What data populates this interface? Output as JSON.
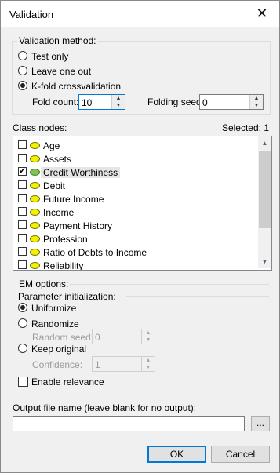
{
  "window": {
    "title": "Validation"
  },
  "validation": {
    "legend": "Validation method:",
    "options": [
      "Test only",
      "Leave one out",
      "K-fold crossvalidation"
    ],
    "selected": "K-fold crossvalidation",
    "fold_count_label": "Fold count:",
    "fold_count": "10",
    "folding_seed_label": "Folding seed:",
    "folding_seed": "0"
  },
  "class_nodes": {
    "label": "Class nodes:",
    "selected_text": "Selected: 1",
    "items": [
      {
        "label": "Age",
        "checked": false,
        "color": "yellow"
      },
      {
        "label": "Assets",
        "checked": false,
        "color": "yellow"
      },
      {
        "label": "Credit Worthiness",
        "checked": true,
        "color": "green"
      },
      {
        "label": "Debit",
        "checked": false,
        "color": "yellow"
      },
      {
        "label": "Future Income",
        "checked": false,
        "color": "yellow"
      },
      {
        "label": "Income",
        "checked": false,
        "color": "yellow"
      },
      {
        "label": "Payment History",
        "checked": false,
        "color": "yellow"
      },
      {
        "label": "Profession",
        "checked": false,
        "color": "yellow"
      },
      {
        "label": "Ratio of Debts to Income",
        "checked": false,
        "color": "yellow"
      },
      {
        "label": "Reliability",
        "checked": false,
        "color": "yellow"
      }
    ]
  },
  "em_options": {
    "legend": "EM options:",
    "param_init_label": "Parameter initialization:",
    "options": [
      "Uniformize",
      "Randomize",
      "Keep original"
    ],
    "selected": "Uniformize",
    "random_seed_label": "Random seed:",
    "random_seed": "0",
    "confidence_label": "Confidence:",
    "confidence": "1",
    "enable_relevance_label": "Enable relevance",
    "enable_relevance": false
  },
  "output": {
    "label": "Output file name (leave blank for no output):",
    "value": "",
    "browse_label": "..."
  },
  "buttons": {
    "ok": "OK",
    "cancel": "Cancel"
  },
  "colors": {
    "node_yellow": "#f2f200",
    "node_green": "#7dc552",
    "accent": "#0078d7"
  },
  "icons": {
    "close": "close-icon",
    "spin_up": "spin-up-icon",
    "spin_down": "spin-down-icon"
  }
}
